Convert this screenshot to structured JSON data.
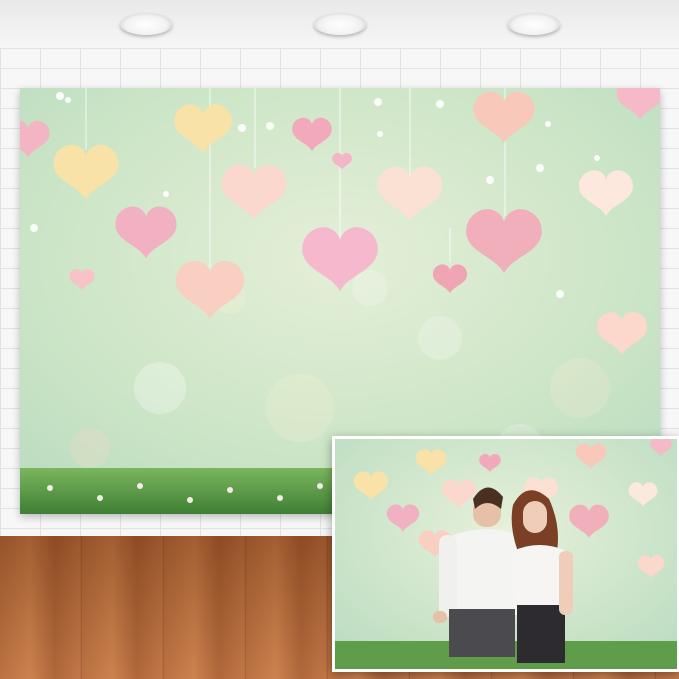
{
  "scene": {
    "colors": {
      "wall": "#f7f7f7",
      "floor": "#b5693a",
      "backdrop_green": "#cfe6c8",
      "grass": "#5f9d4a",
      "heart_pink": "#f4b6c6",
      "heart_peach": "#f8d0c0",
      "heart_yellow": "#f8e2a8",
      "heart_cream": "#fbe6da"
    },
    "icons": [
      "heart-icon",
      "ceiling-light-icon",
      "grass-icon",
      "flower-icon",
      "person-icon"
    ]
  }
}
